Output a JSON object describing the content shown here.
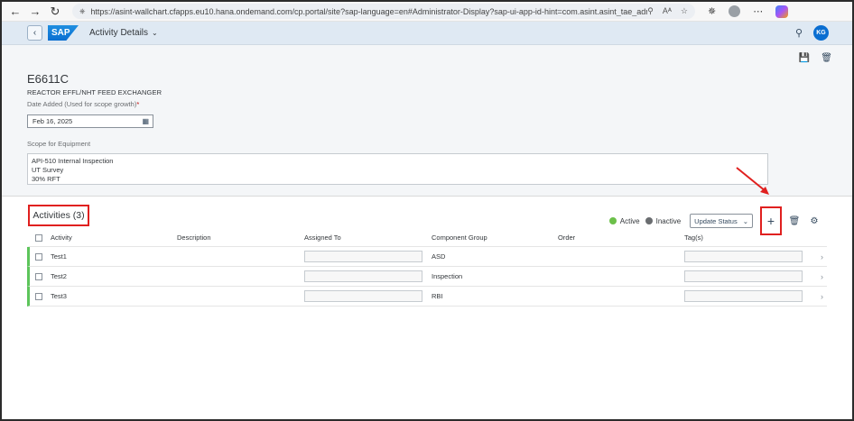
{
  "browser": {
    "url": "https://asint-wallchart.cfapps.eu10.hana.ondemand.com/cp.portal/site?sap-language=en#Administrator-Display?sap-ui-app-id-hint=com.asint.asint_tae_admin&/Act...",
    "read_aloud_label": "Aᴬ"
  },
  "shell": {
    "title": "Activity Details",
    "avatar_initials": "KG"
  },
  "header": {
    "equipment_id": "E6611C",
    "equipment_desc": "REACTOR EFFL/NHT FEED EXCHANGER",
    "date_label": "Date Added (Used for scope growth)",
    "date_required": "*",
    "date_value": "Feb 16, 2025",
    "scope_label": "Scope for Equipment",
    "scope_lines": [
      "API-510 Internal Inspection",
      "UT Survey",
      "30% RFT"
    ]
  },
  "activities": {
    "title": "Activities (3)",
    "legend_active": "Active",
    "legend_inactive": "Inactive",
    "active_color": "#6cc04a",
    "inactive_color": "#6a6d70",
    "update_status_label": "Update Status",
    "columns": [
      "Activity",
      "Description",
      "Assigned To",
      "Component Group",
      "Order",
      "Tag(s)"
    ],
    "rows": [
      {
        "activity": "Test1",
        "component_group": "ASD"
      },
      {
        "activity": "Test2",
        "component_group": "Inspection"
      },
      {
        "activity": "Test3",
        "component_group": "RBI"
      }
    ]
  }
}
